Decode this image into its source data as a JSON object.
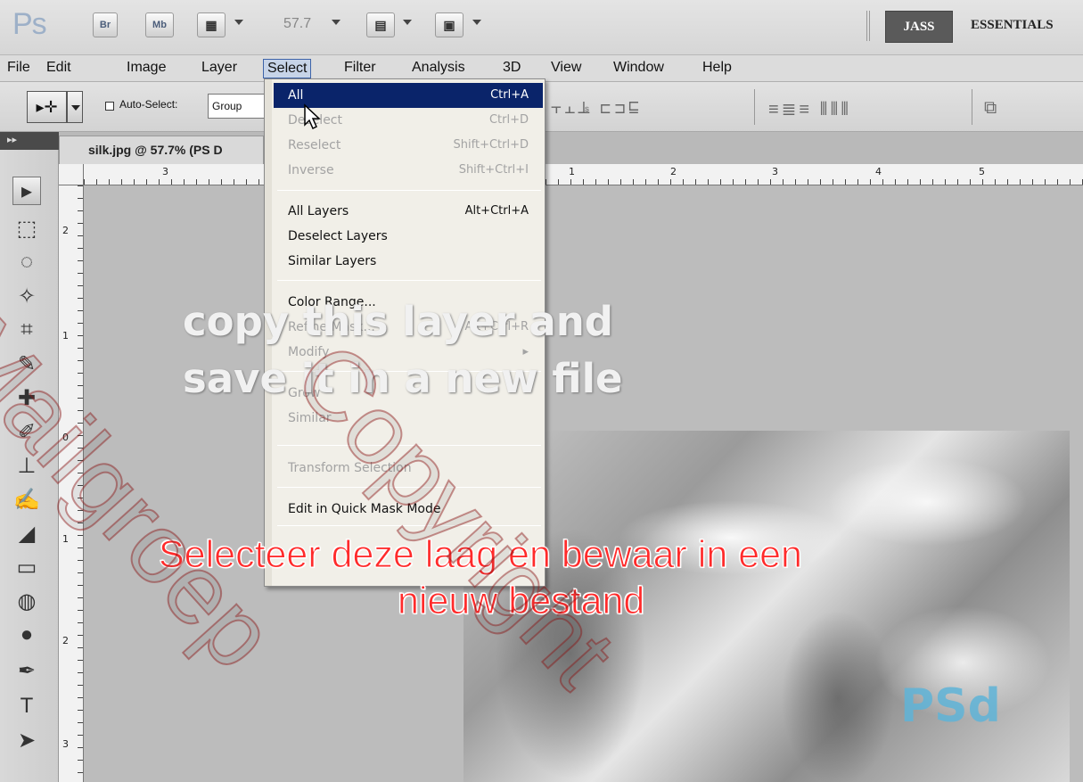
{
  "appbar": {
    "logo": "Ps",
    "bridge_label": "Br",
    "minibridge_label": "Mb",
    "zoom": "57.7",
    "workspace_active": "JASS",
    "workspace_essentials": "ESSENTIALS"
  },
  "menubar": {
    "items": [
      "File",
      "Edit",
      "Image",
      "Layer",
      "Select",
      "Filter",
      "Analysis",
      "3D",
      "View",
      "Window",
      "Help"
    ]
  },
  "options": {
    "auto_select_label": "Auto-Select:",
    "auto_select_value": "Group"
  },
  "document": {
    "tab_title": "silk.jpg @ 57.7% (PS D"
  },
  "rulers": {
    "top": [
      "3",
      "1",
      "2",
      "3",
      "4",
      "5"
    ],
    "left": [
      "2",
      "1",
      "0",
      "1",
      "2",
      "3"
    ]
  },
  "select_menu": {
    "items": [
      {
        "label": "All",
        "shortcut": "Ctrl+A",
        "state": "highlighted"
      },
      {
        "label": "Deselect",
        "shortcut": "Ctrl+D",
        "state": "disabled"
      },
      {
        "label": "Reselect",
        "shortcut": "Shift+Ctrl+D",
        "state": "disabled"
      },
      {
        "label": "Inverse",
        "shortcut": "Shift+Ctrl+I",
        "state": "disabled"
      },
      {
        "label": "All Layers",
        "shortcut": "Alt+Ctrl+A",
        "state": "enabled"
      },
      {
        "label": "Deselect Layers",
        "shortcut": "",
        "state": "enabled"
      },
      {
        "label": "Similar Layers",
        "shortcut": "",
        "state": "enabled"
      },
      {
        "label": "Color Range...",
        "shortcut": "",
        "state": "enabled"
      },
      {
        "label": "Refine Mask...",
        "shortcut": "Alt+Ctrl+R",
        "state": "disabled"
      },
      {
        "label": "Modify",
        "shortcut": "",
        "state": "disabled"
      },
      {
        "label": "Grow",
        "shortcut": "",
        "state": "disabled"
      },
      {
        "label": "Similar",
        "shortcut": "",
        "state": "disabled"
      },
      {
        "label": "Transform Selection",
        "shortcut": "",
        "state": "disabled"
      },
      {
        "label": "Edit in Quick Mask Mode",
        "shortcut": "",
        "state": "enabled"
      }
    ]
  },
  "captions": {
    "english_line1": "copy this layer and",
    "english_line2": "save it in a new file",
    "dutch_line1": "Selecteer deze laag en bewaar in een",
    "dutch_line2": "nieuw bestand"
  },
  "watermark": {
    "line1": "Mailgroep",
    "line2": "Copyright"
  },
  "photo_logo": "PSd",
  "colors": {
    "menu_highlight": "#0a246a",
    "dutch_caption": "#ff2b2b",
    "english_caption": "#f1f1f1",
    "psd_logo": "#5fb4d8"
  }
}
